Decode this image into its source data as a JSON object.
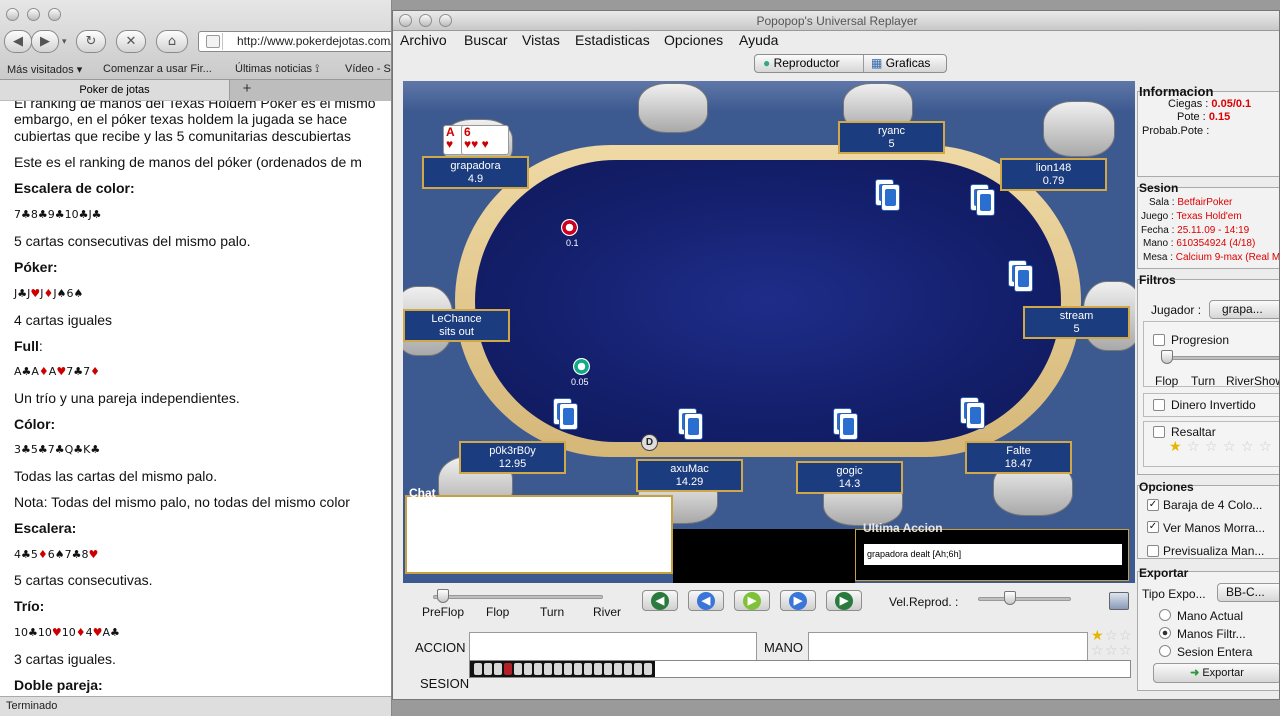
{
  "browser": {
    "url": "http://www.pokerdejotas.com/",
    "bookmarks": [
      "Más visitados ▾",
      "Comenzar a usar Fir...",
      "Últimas noticias ⟟",
      "Vídeo - S"
    ],
    "tab_title": "Poker de jotas",
    "status": "Terminado",
    "content": {
      "line1": "El ranking de manos del Texas Holdem Poker es el mismo",
      "line2": "embargo, en el póker texas holdem la jugada se hace",
      "line3": "cubiertas que recibe y las 5 comunitarias descubiertas",
      "line4": "Este es el ranking de manos del póker (ordenados de m",
      "h_escalera_color": "Escalera de color:",
      "d_escalera_color": "5 cartas consecutivas del mismo palo.",
      "h_poker": "Póker:",
      "d_poker": "4 cartas iguales",
      "h_full": "Full",
      "d_full": "Un trío y una pareja independientes.",
      "h_color": "Cólor:",
      "d_color": "Todas las cartas del mismo palo.",
      "nota": "Nota: Todas del mismo palo, no todas del mismo color",
      "h_escalera": "Escalera:",
      "d_escalera": "5 cartas consecutivas.",
      "h_trio": "Trío:",
      "d_trio": "3 cartas iguales.",
      "h_doble": "Doble pareja:"
    }
  },
  "app": {
    "title": "Popopop's Universal Replayer",
    "menus": [
      "Archivo",
      "Buscar",
      "Vistas",
      "Estadisticas",
      "Opciones",
      "Ayuda"
    ],
    "tabs": [
      "Reproductor",
      "Graficas"
    ],
    "seats": [
      {
        "name": "grapadora",
        "stack": "4.9"
      },
      {
        "name": "ryanc",
        "stack": "5"
      },
      {
        "name": "lion148",
        "stack": "0.79"
      },
      {
        "name": "LeChance",
        "stack": "sits out"
      },
      {
        "name": "stream",
        "stack": "5"
      },
      {
        "name": "p0k3rB0y",
        "stack": "12.95"
      },
      {
        "name": "axuMac",
        "stack": "14.29"
      },
      {
        "name": "gogic",
        "stack": "14.3"
      },
      {
        "name": "Falte",
        "stack": "18.47"
      }
    ],
    "hero_cards": [
      "A",
      "6"
    ],
    "chip1": "0.1",
    "chip2": "0.05",
    "dealer": "D",
    "chat_label": "Chat",
    "ultima_label": "Ultima Accion",
    "ultima_value": "grapadora dealt [Ah;6h]",
    "stages": [
      "PreFlop",
      "Flop",
      "Turn",
      "River"
    ],
    "vel_label": "Vel.Reprod. :",
    "accion_label": "ACCION",
    "mano_label": "MANO",
    "sesion_label": "SESION",
    "progress": 0.28
  },
  "sidebar": {
    "info_title": "Informacion",
    "ciegas_label": "Ciegas :",
    "ciegas_value": "0.05/0.1",
    "pote_label": "Pote :",
    "pote_value": "0.15",
    "probab_label": "Probab.Pote :",
    "sesion_title": "Sesion",
    "sala_label": "Sala :",
    "sala_value": "BetfairPoker",
    "juego_label": "Juego :",
    "juego_value": "Texas Hold'em",
    "fecha_label": "Fecha :",
    "fecha_value": "25.11.09 - 14:19",
    "mano_label": "Mano :",
    "mano_value": "610354924 (4/18)",
    "mesa_label": "Mesa :",
    "mesa_value": "Calcium 9-max (Real M",
    "filtros_title": "Filtros",
    "jugador_label": "Jugador :",
    "jugador_value": "grapa...",
    "progresion_label": "Progresion",
    "prog_stages": [
      "Flop",
      "Turn",
      "RiverShow"
    ],
    "dinero_label": "Dinero Invertido",
    "resaltar_label": "Resaltar",
    "opciones_title": "Opciones",
    "opt1": "Baraja de 4 Colo...",
    "opt2": "Ver Manos Morra...",
    "opt3": "Previsualiza Man...",
    "exportar_title": "Exportar",
    "tipo_label": "Tipo Expo...",
    "tipo_value": "BB-C...",
    "radio1": "Mano Actual",
    "radio2": "Manos Filtr...",
    "radio3": "Sesion Entera",
    "export_btn": "Exportar"
  },
  "colors": {
    "felt": "#131f6a",
    "rail": "#d5b778",
    "seat_border": "#d0a848",
    "accent_red": "#d00"
  }
}
